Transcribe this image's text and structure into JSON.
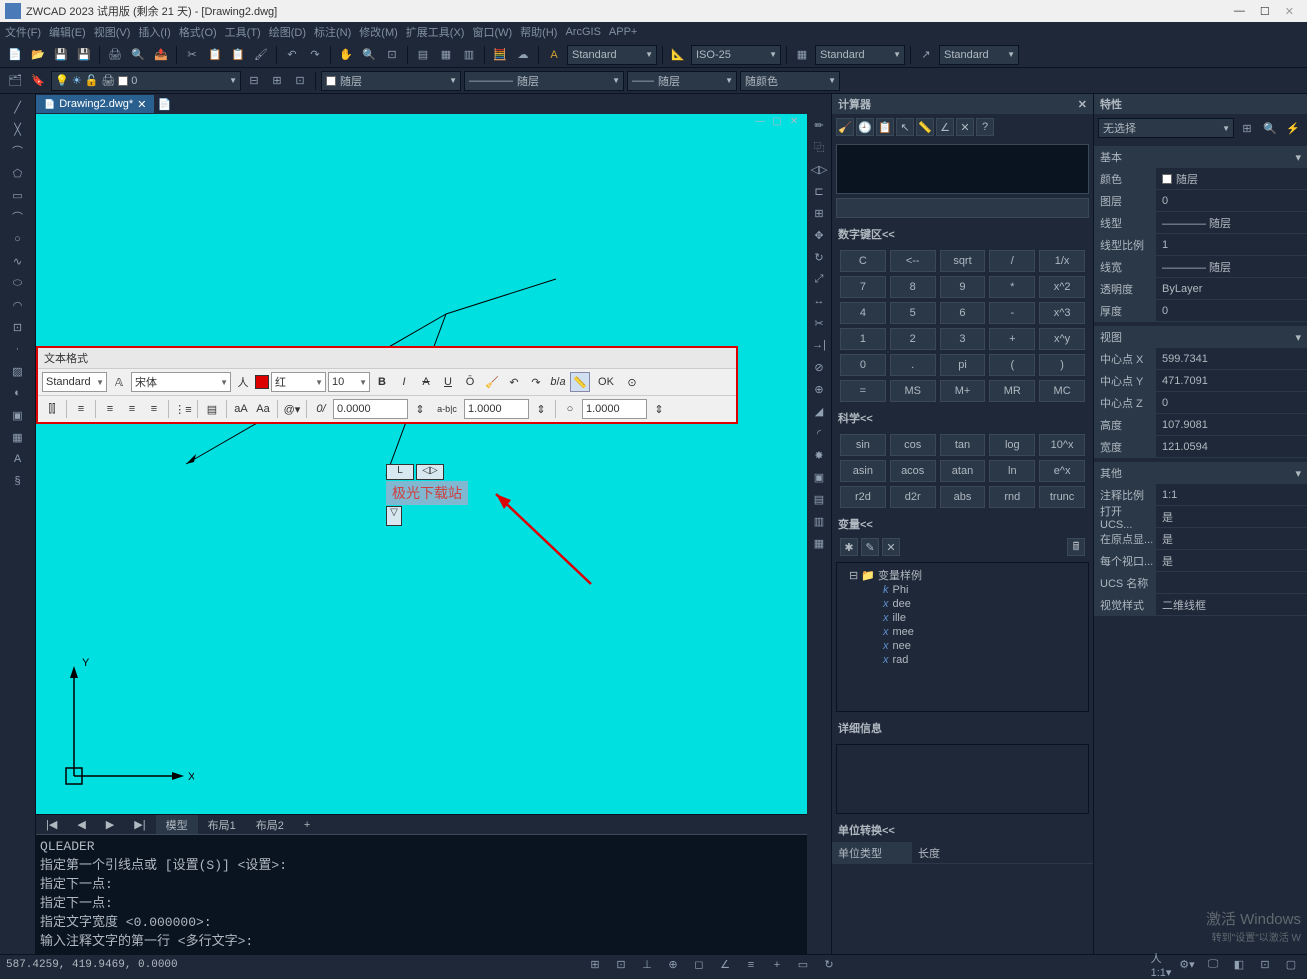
{
  "title_bar": {
    "app_title": "ZWCAD 2023 试用版 (剩余 21 天) - [Drawing2.dwg]"
  },
  "menu": {
    "items": [
      "文件(F)",
      "编辑(E)",
      "视图(V)",
      "插入(I)",
      "格式(O)",
      "工具(T)",
      "绘图(D)",
      "标注(N)",
      "修改(M)",
      "扩展工具(X)",
      "窗口(W)",
      "帮助(H)",
      "ArcGIS",
      "APP+"
    ]
  },
  "style_bar": {
    "text_style": "Standard",
    "dim_style": "ISO-25",
    "table_style": "Standard",
    "mleader_style": "Standard"
  },
  "layer_bar": {
    "layer_name": "0",
    "linetype": "随层",
    "linetype2": "随层",
    "lineweight": "随层",
    "color": "随颜色"
  },
  "doc_tab": {
    "name": "Drawing2.dwg*"
  },
  "text_editor": {
    "title": "文本格式",
    "style": "Standard",
    "font": "宋体",
    "color": "红",
    "size": "10",
    "ok": "OK",
    "val1": "0.0000",
    "val2": "1.0000",
    "val3": "1.0000",
    "abc": "a-b|c"
  },
  "leader_text": "极光下载站",
  "leader_L": "L",
  "layout_tabs": {
    "nav": [
      "|◀",
      "◀",
      "▶",
      "▶|"
    ],
    "model": "模型",
    "layout1": "布局1",
    "layout2": "布局2",
    "add": "+"
  },
  "command": {
    "lines": [
      "QLEADER",
      "指定第一个引线点或 [设置(S)] <设置>:",
      "指定下一点:",
      "指定下一点:",
      "指定文字宽度 <0.000000>:",
      "输入注释文字的第一行 <多行文字>:"
    ]
  },
  "status_bar": {
    "coords": "587.4259, 419.9469, 0.0000"
  },
  "calculator": {
    "title": "计算器",
    "keypad_hdr": "数字键区<<",
    "keys": [
      [
        "C",
        "<--",
        "sqrt",
        "/",
        "1/x"
      ],
      [
        "7",
        "8",
        "9",
        "*",
        "x^2"
      ],
      [
        "4",
        "5",
        "6",
        "-",
        "x^3"
      ],
      [
        "1",
        "2",
        "3",
        "+",
        "x^y"
      ],
      [
        "0",
        ".",
        "pi",
        "(",
        ")"
      ],
      [
        "=",
        "MS",
        "M+",
        "MR",
        "MC"
      ]
    ],
    "sci_hdr": "科学<<",
    "sci_keys": [
      [
        "sin",
        "cos",
        "tan",
        "log",
        "10^x"
      ],
      [
        "asin",
        "acos",
        "atan",
        "ln",
        "e^x"
      ],
      [
        "r2d",
        "d2r",
        "abs",
        "rnd",
        "trunc"
      ]
    ],
    "var_hdr": "变量<<",
    "var_root": "变量样例",
    "vars": [
      "Phi",
      "dee",
      "ille",
      "mee",
      "nee",
      "rad"
    ],
    "detail_hdr": "详细信息",
    "unit_hdr": "单位转换<<",
    "unit_type_label": "单位类型",
    "unit_type_val": "长度"
  },
  "properties": {
    "title": "特性",
    "selection": "无选择",
    "groups": {
      "basic": {
        "hdr": "基本",
        "rows": [
          {
            "label": "颜色",
            "val": "随层",
            "swatch": true
          },
          {
            "label": "图层",
            "val": "0"
          },
          {
            "label": "线型",
            "val": "———— 随层"
          },
          {
            "label": "线型比例",
            "val": "1"
          },
          {
            "label": "线宽",
            "val": "———— 随层"
          },
          {
            "label": "透明度",
            "val": "ByLayer"
          },
          {
            "label": "厚度",
            "val": "0"
          }
        ]
      },
      "view": {
        "hdr": "视图",
        "rows": [
          {
            "label": "中心点 X",
            "val": "599.7341"
          },
          {
            "label": "中心点 Y",
            "val": "471.7091"
          },
          {
            "label": "中心点 Z",
            "val": "0"
          },
          {
            "label": "高度",
            "val": "107.9081"
          },
          {
            "label": "宽度",
            "val": "121.0594"
          }
        ]
      },
      "other": {
        "hdr": "其他",
        "rows": [
          {
            "label": "注释比例",
            "val": "1:1"
          },
          {
            "label": "打开 UCS...",
            "val": "是"
          },
          {
            "label": "在原点显...",
            "val": "是"
          },
          {
            "label": "每个视口...",
            "val": "是"
          },
          {
            "label": "UCS 名称",
            "val": ""
          },
          {
            "label": "视觉样式",
            "val": "二维线框"
          }
        ]
      }
    }
  },
  "watermark": {
    "line1": "激活 Windows",
    "line2": "转到\"设置\"以激活 W"
  },
  "ucs": {
    "x": "X",
    "y": "Y"
  }
}
